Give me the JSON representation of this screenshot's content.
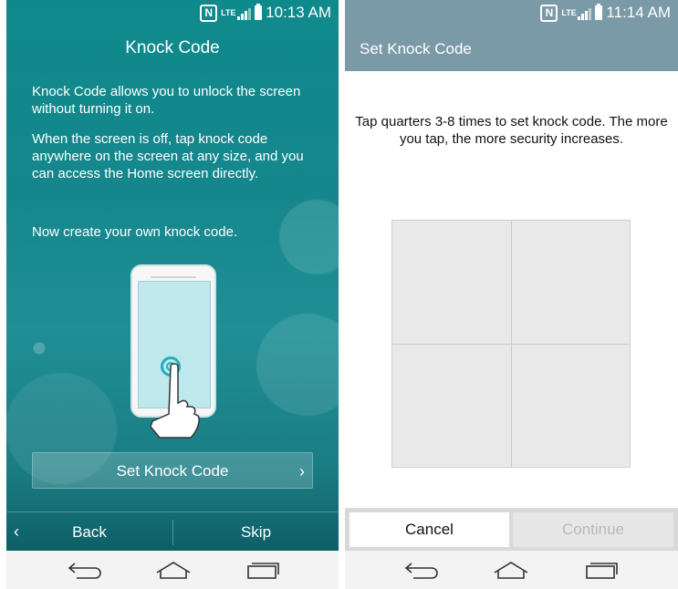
{
  "left": {
    "status": {
      "time": "10:13 AM"
    },
    "title": "Knock Code",
    "paragraphs": [
      "Knock Code allows you to unlock the screen without turning it on.",
      "When the screen is off, tap knock code anywhere on the screen at any size, and you can access the Home screen directly.",
      "Now create your own knock code."
    ],
    "set_button": "Set Knock Code",
    "back_label": "Back",
    "skip_label": "Skip"
  },
  "right": {
    "status": {
      "time": "11:14 AM"
    },
    "title": "Set Knock Code",
    "instructions": "Tap quarters 3-8 times to set knock code. The more you tap, the more security increases.",
    "cancel_label": "Cancel",
    "continue_label": "Continue"
  },
  "icons": {
    "nfc": "nfc-icon",
    "lte": "lte-icon",
    "signal": "signal-icon",
    "battery": "battery-icon",
    "nav_back": "back-arrow-icon",
    "nav_home": "home-icon",
    "nav_recent": "recent-apps-icon"
  },
  "lte_text": "LTE",
  "nfc_text": "N",
  "colors": {
    "left_bg": "#15878c",
    "right_header": "#7b9aa8",
    "grid_fill": "#e9e9e9"
  }
}
